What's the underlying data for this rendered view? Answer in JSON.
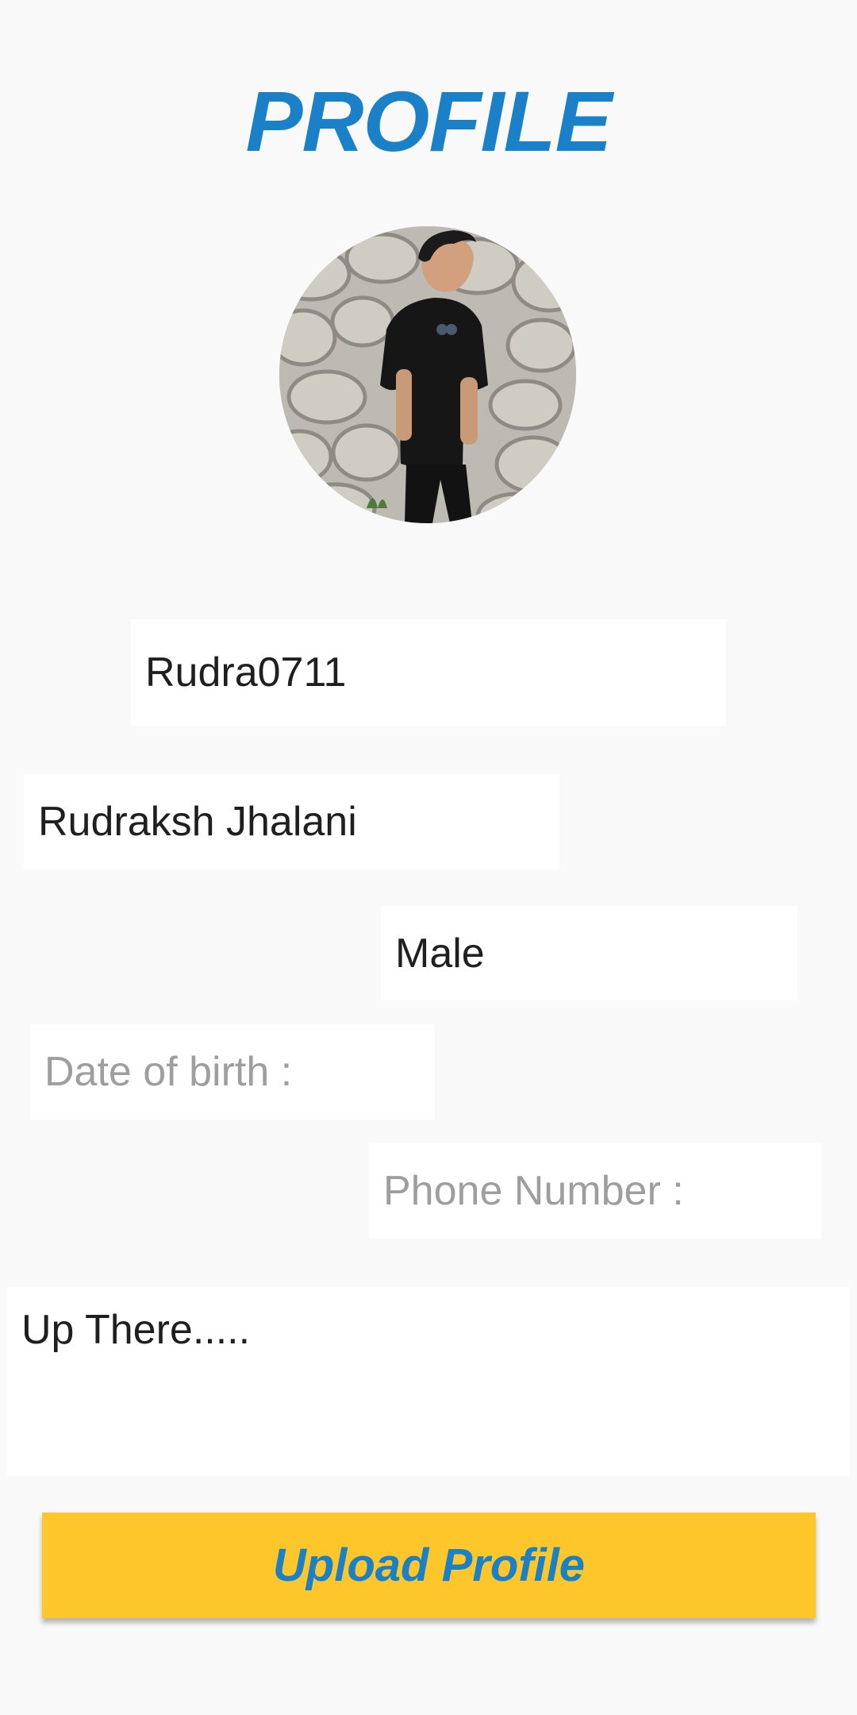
{
  "header": {
    "title": "PROFILE"
  },
  "avatar": {
    "description": "profile-photo"
  },
  "form": {
    "username": {
      "value": "Rudra0711"
    },
    "full_name": {
      "value": "Rudraksh Jhalani"
    },
    "gender": {
      "value": "Male"
    },
    "date_of_birth": {
      "placeholder": "Date of birth :"
    },
    "phone_number": {
      "placeholder": "Phone Number :"
    },
    "bio": {
      "value": "Up There....."
    }
  },
  "actions": {
    "upload_label": "Upload Profile"
  },
  "colors": {
    "accent": "#1a80c8",
    "button_bg": "#fdc62b",
    "background": "#f9f9f9",
    "field_bg": "#ffffff",
    "placeholder": "#9e9e9e"
  }
}
